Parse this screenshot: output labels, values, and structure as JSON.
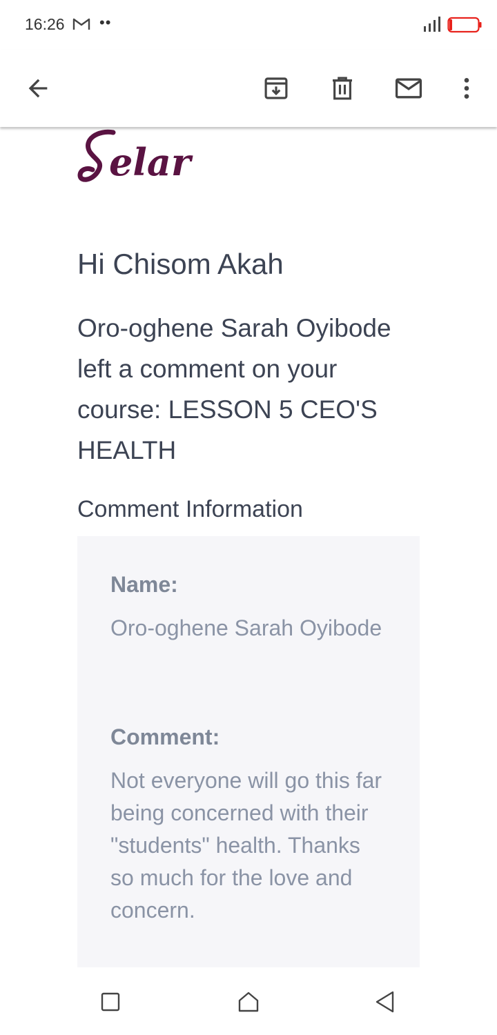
{
  "status_bar": {
    "time": "16:26",
    "notification_icons": [
      "gmail-icon"
    ],
    "overflow_dots": "••",
    "signal_icon": "signal-icon",
    "battery_icon": "battery-low-icon",
    "battery_color": "#e8221c"
  },
  "toolbar": {
    "back_icon": "arrow-left-icon",
    "archive_icon": "archive-icon",
    "delete_icon": "trash-icon",
    "mark_unread_icon": "mail-icon",
    "more_icon": "more-vert-icon"
  },
  "email": {
    "logo_text": "Selar",
    "logo_color": "#5a1342",
    "greeting": "Hi Chisom Akah",
    "message": "Oro-oghene Sarah Oyibode left a comment on your course: LESSON 5 CEO'S HEALTH",
    "section_title": "Comment Information",
    "name_label": "Name:",
    "name_value": "Oro-oghene Sarah Oyibode",
    "comment_label": "Comment:",
    "comment_value": "Not everyone will go this far being concerned with their \"students\" health. Thanks so much for the love and concern."
  },
  "nav_bar": {
    "recent_icon": "square-icon",
    "home_icon": "home-icon",
    "back_icon": "triangle-back-icon"
  }
}
